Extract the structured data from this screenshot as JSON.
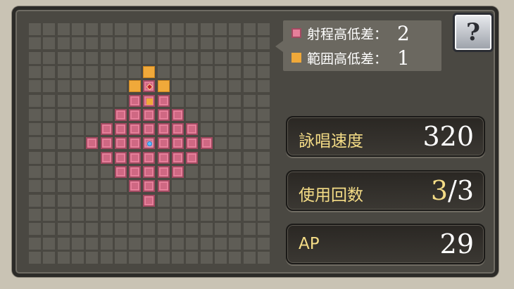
{
  "legend": {
    "range_height_label": "射程高低差：",
    "range_height_value": "2",
    "area_height_label": "範囲高低差：",
    "area_height_value": "1"
  },
  "help": {
    "icon": "question-book-icon",
    "glyph": "?"
  },
  "stats": {
    "cast_speed_label": "詠唱速度",
    "cast_speed_value": "320",
    "uses_label": "使用回数",
    "uses_current": "3",
    "uses_sep_max": "/3",
    "ap_label": "AP",
    "ap_value": "29"
  },
  "colors": {
    "range_cell": "#e67f9a",
    "area_cell": "#f0a93a",
    "label_gold": "#f4dc86"
  }
}
